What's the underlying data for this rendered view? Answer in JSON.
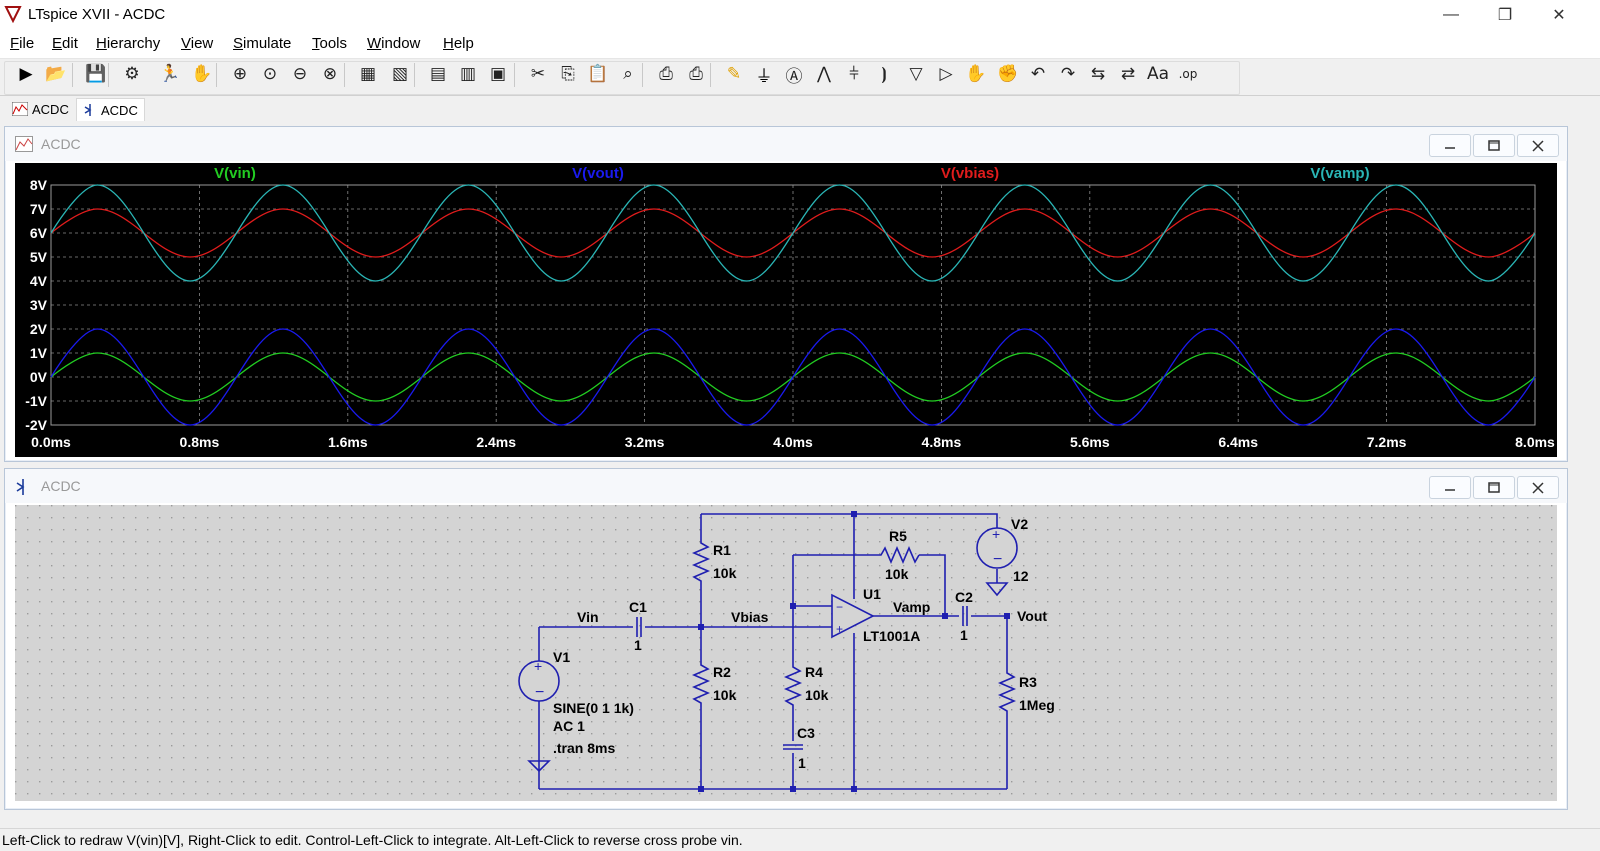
{
  "app_title": "LTspice XVII - ACDC",
  "window_controls": {
    "minimize": "—",
    "restore": "❐",
    "close": "✕"
  },
  "menus": [
    {
      "pre": "",
      "u": "F",
      "post": "ile"
    },
    {
      "pre": "",
      "u": "E",
      "post": "dit"
    },
    {
      "pre": "",
      "u": "H",
      "post": "ierarchy"
    },
    {
      "pre": "",
      "u": "V",
      "post": "iew"
    },
    {
      "pre": "",
      "u": "S",
      "post": "imulate"
    },
    {
      "pre": "",
      "u": "T",
      "post": "ools"
    },
    {
      "pre": "",
      "u": "W",
      "post": "indow"
    },
    {
      "pre": "",
      "u": "H",
      "post": "elp"
    }
  ],
  "toolbar_icons": [
    "run-icon",
    "open-icon",
    "save-icon",
    "control-panel-icon",
    "halt-icon",
    "pan-icon",
    "zoom-in-icon",
    "zoom-area-icon",
    "zoom-out-icon",
    "zoom-cancel-icon",
    "autorange-icon",
    "grid-icon",
    "tile-horizontal-icon",
    "cascade-icon",
    "tile-vertical-icon",
    "cut-icon",
    "copy-icon",
    "paste-icon",
    "find-icon",
    "print-preview-icon",
    "print-icon",
    "draw-wire-icon",
    "ground-icon",
    "label-net-icon",
    "resistor-icon",
    "capacitor-icon",
    "inductor-icon",
    "diode-icon",
    "component-icon",
    "move-icon",
    "drag-icon",
    "undo-icon",
    "redo-icon",
    "rotate-icon",
    "mirror-icon",
    "text-icon",
    "spice-directive-icon"
  ],
  "tabs": [
    {
      "label": "ACDC",
      "icon": "waveform-tab-icon"
    },
    {
      "label": "ACDC",
      "icon": "schematic-tab-icon"
    }
  ],
  "plot_window": {
    "title": "ACDC",
    "chart_data": {
      "type": "line",
      "x": [
        0,
        0.25,
        0.5,
        0.75,
        1.0,
        1.25,
        1.5,
        1.75,
        2.0,
        2.25,
        2.5,
        2.75,
        3.0,
        3.25,
        3.5,
        3.75,
        4.0,
        4.25,
        4.5,
        4.75,
        5.0,
        5.25,
        5.5,
        5.75,
        6.0,
        6.25,
        6.5,
        6.75,
        7.0,
        7.25,
        7.5,
        7.75,
        8.0
      ],
      "series": [
        {
          "name": "V(vin)",
          "color": "#22cc22",
          "values": [
            0,
            1,
            0,
            -1,
            0,
            1,
            0,
            -1,
            0,
            1,
            0,
            -1,
            0,
            1,
            0,
            -1,
            0,
            1,
            0,
            -1,
            0,
            1,
            0,
            -1,
            0,
            1,
            0,
            -1,
            0,
            1,
            0,
            -1,
            0
          ]
        },
        {
          "name": "V(vout)",
          "color": "#1a1aee",
          "values": [
            0,
            2,
            0,
            -2,
            0,
            2,
            0,
            -2,
            0,
            2,
            0,
            -2,
            0,
            2,
            0,
            -2,
            0,
            2,
            0,
            -2,
            0,
            2,
            0,
            -2,
            0,
            2,
            0,
            -2,
            0,
            2,
            0,
            -2,
            0
          ]
        },
        {
          "name": "V(vbias)",
          "color": "#e01c1c",
          "values": [
            6,
            7,
            6,
            5,
            6,
            7,
            6,
            5,
            6,
            7,
            6,
            5,
            6,
            7,
            6,
            5,
            6,
            7,
            6,
            5,
            6,
            7,
            6,
            5,
            6,
            7,
            6,
            5,
            6,
            7,
            6,
            5,
            6
          ]
        },
        {
          "name": "V(vamp)",
          "color": "#2ab5b5",
          "values": [
            6,
            8,
            6,
            4,
            6,
            8,
            6,
            4,
            6,
            8,
            6,
            4,
            6,
            8,
            6,
            4,
            6,
            8,
            6,
            4,
            6,
            8,
            6,
            4,
            6,
            8,
            6,
            4,
            6,
            8,
            6,
            4,
            6
          ]
        }
      ],
      "xlim": [
        0,
        8
      ],
      "ylim": [
        -2,
        8
      ],
      "x_ticks": [
        "0.0ms",
        "0.8ms",
        "1.6ms",
        "2.4ms",
        "3.2ms",
        "4.0ms",
        "4.8ms",
        "5.6ms",
        "6.4ms",
        "7.2ms",
        "8.0ms"
      ],
      "y_ticks": [
        "8V",
        "7V",
        "6V",
        "5V",
        "4V",
        "3V",
        "2V",
        "1V",
        "0V",
        "-1V",
        "-2V"
      ],
      "grid": true,
      "legend": "top"
    }
  },
  "schematic_window": {
    "title": "ACDC",
    "labels": {
      "R1": "R1",
      "R1_val": "10k",
      "R2": "R2",
      "R2_val": "10k",
      "R3": "R3",
      "R3_val": "1Meg",
      "R4": "R4",
      "R4_val": "10k",
      "R5": "R5",
      "R5_val": "10k",
      "C1": "C1",
      "C1_val": "1",
      "C2": "C2",
      "C2_val": "1",
      "C3": "C3",
      "C3_val": "1",
      "U1": "U1",
      "U1_val": "LT1001A",
      "V1": "V1",
      "V1_val1": "SINE(0 1 1k)",
      "V1_val2": "AC 1",
      "V2": "V2",
      "V2_val": "12",
      "net_vin": "Vin",
      "net_vbias": "Vbias",
      "net_vamp": "Vamp",
      "net_vout": "Vout",
      "directive": ".tran 8ms"
    }
  },
  "status_text": "Left-Click to redraw V(vin)[V],  Right-Click to edit. Control-Left-Click to integrate. Alt-Left-Click to reverse cross probe vin."
}
